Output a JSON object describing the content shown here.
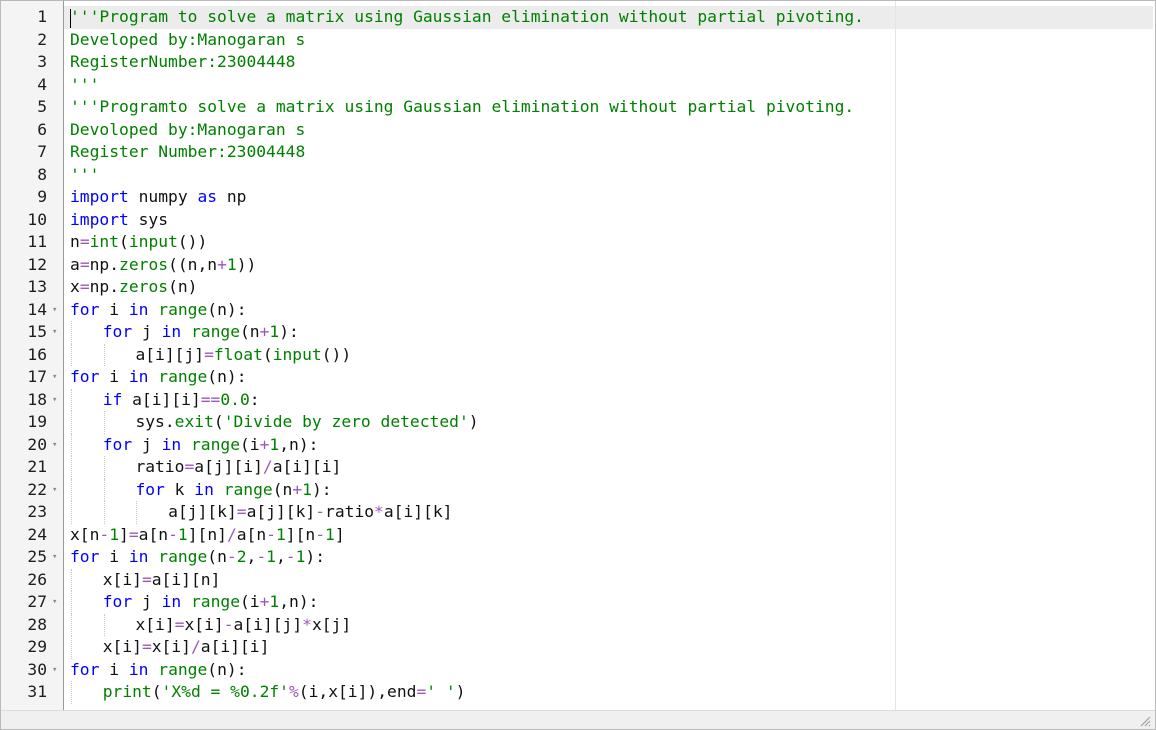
{
  "editor": {
    "lines": [
      {
        "n": "1",
        "fold": "",
        "indent": 0,
        "tokens": [
          [
            "cm",
            "'''Program to solve a matrix using Gaussian elimination without partial pivoting."
          ]
        ]
      },
      {
        "n": "2",
        "fold": "",
        "indent": 0,
        "tokens": [
          [
            "cm",
            "Developed by:Manogaran s"
          ]
        ]
      },
      {
        "n": "3",
        "fold": "",
        "indent": 0,
        "tokens": [
          [
            "cm",
            "RegisterNumber:23004448"
          ]
        ]
      },
      {
        "n": "4",
        "fold": "",
        "indent": 0,
        "tokens": [
          [
            "cm",
            "'''"
          ]
        ]
      },
      {
        "n": "5",
        "fold": "",
        "indent": 0,
        "tokens": [
          [
            "cm",
            "'''Programto solve a matrix using Gaussian elimination without partial pivoting."
          ]
        ]
      },
      {
        "n": "6",
        "fold": "",
        "indent": 0,
        "tokens": [
          [
            "cm",
            "Devoloped by:Manogaran s"
          ]
        ]
      },
      {
        "n": "7",
        "fold": "",
        "indent": 0,
        "tokens": [
          [
            "cm",
            "Register Number:23004448"
          ]
        ]
      },
      {
        "n": "8",
        "fold": "",
        "indent": 0,
        "tokens": [
          [
            "cm",
            "'''"
          ]
        ]
      },
      {
        "n": "9",
        "fold": "",
        "indent": 0,
        "tokens": [
          [
            "kw",
            "import"
          ],
          [
            "id",
            " numpy "
          ],
          [
            "kw",
            "as"
          ],
          [
            "id",
            " np"
          ]
        ]
      },
      {
        "n": "10",
        "fold": "",
        "indent": 0,
        "tokens": [
          [
            "kw",
            "import"
          ],
          [
            "id",
            " sys"
          ]
        ]
      },
      {
        "n": "11",
        "fold": "",
        "indent": 0,
        "tokens": [
          [
            "id",
            "n"
          ],
          [
            "op",
            "="
          ],
          [
            "fn",
            "int"
          ],
          [
            "id",
            "("
          ],
          [
            "fn",
            "input"
          ],
          [
            "id",
            "())"
          ]
        ]
      },
      {
        "n": "12",
        "fold": "",
        "indent": 0,
        "tokens": [
          [
            "id",
            "a"
          ],
          [
            "op",
            "="
          ],
          [
            "id",
            "np."
          ],
          [
            "fn",
            "zeros"
          ],
          [
            "id",
            "((n,n"
          ],
          [
            "op",
            "+"
          ],
          [
            "num",
            "1"
          ],
          [
            "id",
            "))"
          ]
        ]
      },
      {
        "n": "13",
        "fold": "",
        "indent": 0,
        "tokens": [
          [
            "id",
            "x"
          ],
          [
            "op",
            "="
          ],
          [
            "id",
            "np."
          ],
          [
            "fn",
            "zeros"
          ],
          [
            "id",
            "(n)"
          ]
        ]
      },
      {
        "n": "14",
        "fold": "▾",
        "indent": 0,
        "tokens": [
          [
            "kw",
            "for"
          ],
          [
            "id",
            " i "
          ],
          [
            "kw",
            "in"
          ],
          [
            "id",
            " "
          ],
          [
            "fn",
            "range"
          ],
          [
            "id",
            "(n):"
          ]
        ]
      },
      {
        "n": "15",
        "fold": "▾",
        "indent": 1,
        "tokens": [
          [
            "kw",
            "for"
          ],
          [
            "id",
            " j "
          ],
          [
            "kw",
            "in"
          ],
          [
            "id",
            " "
          ],
          [
            "fn",
            "range"
          ],
          [
            "id",
            "(n"
          ],
          [
            "op",
            "+"
          ],
          [
            "num",
            "1"
          ],
          [
            "id",
            "):"
          ]
        ]
      },
      {
        "n": "16",
        "fold": "",
        "indent": 2,
        "tokens": [
          [
            "id",
            "a[i][j]"
          ],
          [
            "op",
            "="
          ],
          [
            "fn",
            "float"
          ],
          [
            "id",
            "("
          ],
          [
            "fn",
            "input"
          ],
          [
            "id",
            "())"
          ]
        ]
      },
      {
        "n": "17",
        "fold": "▾",
        "indent": 0,
        "tokens": [
          [
            "kw",
            "for"
          ],
          [
            "id",
            " i "
          ],
          [
            "kw",
            "in"
          ],
          [
            "id",
            " "
          ],
          [
            "fn",
            "range"
          ],
          [
            "id",
            "(n):"
          ]
        ]
      },
      {
        "n": "18",
        "fold": "▾",
        "indent": 1,
        "tokens": [
          [
            "kw",
            "if"
          ],
          [
            "id",
            " a[i][i]"
          ],
          [
            "op",
            "=="
          ],
          [
            "num",
            "0.0"
          ],
          [
            "id",
            ":"
          ]
        ]
      },
      {
        "n": "19",
        "fold": "",
        "indent": 2,
        "tokens": [
          [
            "id",
            "sys."
          ],
          [
            "fn",
            "exit"
          ],
          [
            "id",
            "("
          ],
          [
            "str",
            "'Divide by zero detected'"
          ],
          [
            "id",
            ")"
          ]
        ]
      },
      {
        "n": "20",
        "fold": "▾",
        "indent": 1,
        "tokens": [
          [
            "kw",
            "for"
          ],
          [
            "id",
            " j "
          ],
          [
            "kw",
            "in"
          ],
          [
            "id",
            " "
          ],
          [
            "fn",
            "range"
          ],
          [
            "id",
            "(i"
          ],
          [
            "op",
            "+"
          ],
          [
            "num",
            "1"
          ],
          [
            "id",
            ",n):"
          ]
        ]
      },
      {
        "n": "21",
        "fold": "",
        "indent": 2,
        "tokens": [
          [
            "id",
            "ratio"
          ],
          [
            "op",
            "="
          ],
          [
            "id",
            "a[j][i]"
          ],
          [
            "op",
            "/"
          ],
          [
            "id",
            "a[i][i]"
          ]
        ]
      },
      {
        "n": "22",
        "fold": "▾",
        "indent": 2,
        "tokens": [
          [
            "kw",
            "for"
          ],
          [
            "id",
            " k "
          ],
          [
            "kw",
            "in"
          ],
          [
            "id",
            " "
          ],
          [
            "fn",
            "range"
          ],
          [
            "id",
            "(n"
          ],
          [
            "op",
            "+"
          ],
          [
            "num",
            "1"
          ],
          [
            "id",
            "):"
          ]
        ]
      },
      {
        "n": "23",
        "fold": "",
        "indent": 3,
        "tokens": [
          [
            "id",
            "a[j][k]"
          ],
          [
            "op",
            "="
          ],
          [
            "id",
            "a[j][k]"
          ],
          [
            "op",
            "-"
          ],
          [
            "id",
            "ratio"
          ],
          [
            "op",
            "*"
          ],
          [
            "id",
            "a[i][k]"
          ]
        ]
      },
      {
        "n": "24",
        "fold": "",
        "indent": 0,
        "tokens": [
          [
            "id",
            "x[n"
          ],
          [
            "op",
            "-"
          ],
          [
            "num",
            "1"
          ],
          [
            "id",
            "]"
          ],
          [
            "op",
            "="
          ],
          [
            "id",
            "a[n"
          ],
          [
            "op",
            "-"
          ],
          [
            "num",
            "1"
          ],
          [
            "id",
            "][n]"
          ],
          [
            "op",
            "/"
          ],
          [
            "id",
            "a[n"
          ],
          [
            "op",
            "-"
          ],
          [
            "num",
            "1"
          ],
          [
            "id",
            "][n"
          ],
          [
            "op",
            "-"
          ],
          [
            "num",
            "1"
          ],
          [
            "id",
            "]"
          ]
        ]
      },
      {
        "n": "25",
        "fold": "▾",
        "indent": 0,
        "tokens": [
          [
            "kw",
            "for"
          ],
          [
            "id",
            " i "
          ],
          [
            "kw",
            "in"
          ],
          [
            "id",
            " "
          ],
          [
            "fn",
            "range"
          ],
          [
            "id",
            "(n"
          ],
          [
            "op",
            "-"
          ],
          [
            "num",
            "2"
          ],
          [
            "id",
            ","
          ],
          [
            "op",
            "-"
          ],
          [
            "num",
            "1"
          ],
          [
            "id",
            ","
          ],
          [
            "op",
            "-"
          ],
          [
            "num",
            "1"
          ],
          [
            "id",
            "):"
          ]
        ]
      },
      {
        "n": "26",
        "fold": "",
        "indent": 1,
        "tokens": [
          [
            "id",
            "x[i]"
          ],
          [
            "op",
            "="
          ],
          [
            "id",
            "a[i][n]"
          ]
        ]
      },
      {
        "n": "27",
        "fold": "▾",
        "indent": 1,
        "tokens": [
          [
            "kw",
            "for"
          ],
          [
            "id",
            " j "
          ],
          [
            "kw",
            "in"
          ],
          [
            "id",
            " "
          ],
          [
            "fn",
            "range"
          ],
          [
            "id",
            "(i"
          ],
          [
            "op",
            "+"
          ],
          [
            "num",
            "1"
          ],
          [
            "id",
            ",n):"
          ]
        ]
      },
      {
        "n": "28",
        "fold": "",
        "indent": 2,
        "tokens": [
          [
            "id",
            "x[i]"
          ],
          [
            "op",
            "="
          ],
          [
            "id",
            "x[i]"
          ],
          [
            "op",
            "-"
          ],
          [
            "id",
            "a[i][j]"
          ],
          [
            "op",
            "*"
          ],
          [
            "id",
            "x[j]"
          ]
        ]
      },
      {
        "n": "29",
        "fold": "",
        "indent": 1,
        "tokens": [
          [
            "id",
            "x[i]"
          ],
          [
            "op",
            "="
          ],
          [
            "id",
            "x[i]"
          ],
          [
            "op",
            "/"
          ],
          [
            "id",
            "a[i][i]"
          ]
        ]
      },
      {
        "n": "30",
        "fold": "▾",
        "indent": 0,
        "tokens": [
          [
            "kw",
            "for"
          ],
          [
            "id",
            " i "
          ],
          [
            "kw",
            "in"
          ],
          [
            "id",
            " "
          ],
          [
            "fn",
            "range"
          ],
          [
            "id",
            "(n):"
          ]
        ]
      },
      {
        "n": "31",
        "fold": "",
        "indent": 1,
        "tokens": [
          [
            "fn",
            "print"
          ],
          [
            "id",
            "("
          ],
          [
            "str",
            "'X%d = %0.2f'"
          ],
          [
            "op",
            "%"
          ],
          [
            "id",
            "(i,x[i]),end"
          ],
          [
            "op",
            "="
          ],
          [
            "str",
            "' '"
          ],
          [
            "id",
            ")"
          ]
        ]
      }
    ]
  },
  "icons": {
    "fold_marker": "fold-arrow-icon",
    "resize": "resize-grip-icon"
  },
  "colors": {
    "keyword": "#0000ff",
    "string": "#008000",
    "operator": "#9b59b6",
    "active_line": "#ececec"
  }
}
